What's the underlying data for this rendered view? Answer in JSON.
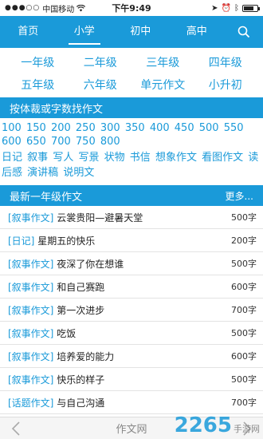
{
  "status": {
    "carrier": "中国移动",
    "time": "下午9:49"
  },
  "nav": {
    "tabs": [
      "首页",
      "小学",
      "初中",
      "高中"
    ],
    "active_index": 1
  },
  "grades": [
    "一年级",
    "二年级",
    "三年级",
    "四年级",
    "五年级",
    "六年级",
    "单元作文",
    "小升初"
  ],
  "search_section": {
    "title": "按体裁或字数找作文"
  },
  "word_counts": [
    "100",
    "150",
    "200",
    "250",
    "300",
    "350",
    "400",
    "450",
    "500",
    "550",
    "600",
    "650",
    "700",
    "750",
    "800"
  ],
  "genres": [
    "日记",
    "叙事",
    "写人",
    "写景",
    "状物",
    "书信",
    "想象作文",
    "看图作文",
    "读后感",
    "演讲稿",
    "说明文"
  ],
  "latest": {
    "title": "最新一年级作文",
    "more": "更多...",
    "items": [
      {
        "cat": "[叙事作文]",
        "title": "云裳贵阳—避暑天堂",
        "words": "500字"
      },
      {
        "cat": "[日记]",
        "title": "星期五的快乐",
        "words": "200字"
      },
      {
        "cat": "[叙事作文]",
        "title": "夜深了你在想谁",
        "words": "500字"
      },
      {
        "cat": "[叙事作文]",
        "title": "和自己赛跑",
        "words": "600字"
      },
      {
        "cat": "[叙事作文]",
        "title": "第一次进步",
        "words": "700字"
      },
      {
        "cat": "[叙事作文]",
        "title": "吃饭",
        "words": "500字"
      },
      {
        "cat": "[叙事作文]",
        "title": "培养爱的能力",
        "words": "600字"
      },
      {
        "cat": "[叙事作文]",
        "title": "快乐的样子",
        "words": "500字"
      },
      {
        "cat": "[话题作文]",
        "title": "与自己沟通",
        "words": "700字"
      }
    ]
  },
  "bottom": {
    "title": "作文网"
  },
  "watermark": {
    "brand": "2265",
    "suffix": "手游网"
  },
  "colors": {
    "accent": "#1a9ad9"
  }
}
